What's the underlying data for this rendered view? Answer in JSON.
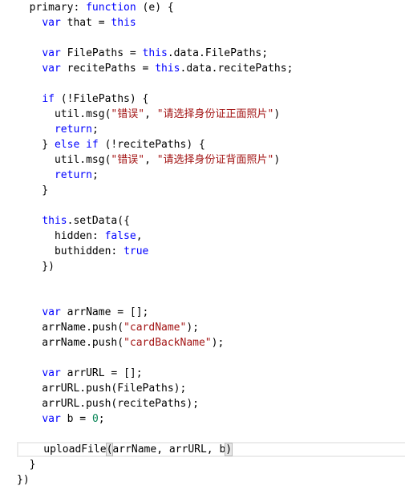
{
  "editor": {
    "current_line": 29,
    "colors": {
      "keyword": "#0000ff",
      "string": "#a31515",
      "number": "#098658",
      "text": "#000000"
    },
    "lines": [
      [
        [
          "t",
          "  primary: "
        ],
        [
          "kw",
          "function"
        ],
        [
          "t",
          " (e) {"
        ]
      ],
      [
        [
          "t",
          "    "
        ],
        [
          "kw",
          "var"
        ],
        [
          "t",
          " that = "
        ],
        [
          "kw",
          "this"
        ]
      ],
      [],
      [
        [
          "t",
          "    "
        ],
        [
          "kw",
          "var"
        ],
        [
          "t",
          " FilePaths = "
        ],
        [
          "kw",
          "this"
        ],
        [
          "t",
          ".data.FilePaths;"
        ]
      ],
      [
        [
          "t",
          "    "
        ],
        [
          "kw",
          "var"
        ],
        [
          "t",
          " recitePaths = "
        ],
        [
          "kw",
          "this"
        ],
        [
          "t",
          ".data.recitePaths;"
        ]
      ],
      [],
      [
        [
          "t",
          "    "
        ],
        [
          "kw",
          "if"
        ],
        [
          "t",
          " (!FilePaths) {"
        ]
      ],
      [
        [
          "t",
          "      util.msg("
        ],
        [
          "str",
          "\"错误\""
        ],
        [
          "t",
          ", "
        ],
        [
          "str",
          "\"请选择身份证正面照片\""
        ],
        [
          "t",
          ")"
        ]
      ],
      [
        [
          "t",
          "      "
        ],
        [
          "kw",
          "return"
        ],
        [
          "t",
          ";"
        ]
      ],
      [
        [
          "t",
          "    } "
        ],
        [
          "kw",
          "else"
        ],
        [
          "t",
          " "
        ],
        [
          "kw",
          "if"
        ],
        [
          "t",
          " (!recitePaths) {"
        ]
      ],
      [
        [
          "t",
          "      util.msg("
        ],
        [
          "str",
          "\"错误\""
        ],
        [
          "t",
          ", "
        ],
        [
          "str",
          "\"请选择身份证背面照片\""
        ],
        [
          "t",
          ")"
        ]
      ],
      [
        [
          "t",
          "      "
        ],
        [
          "kw",
          "return"
        ],
        [
          "t",
          ";"
        ]
      ],
      [
        [
          "t",
          "    }"
        ]
      ],
      [],
      [
        [
          "t",
          "    "
        ],
        [
          "kw",
          "this"
        ],
        [
          "t",
          ".setData({"
        ]
      ],
      [
        [
          "t",
          "      hidden: "
        ],
        [
          "kw",
          "false"
        ],
        [
          "t",
          ","
        ]
      ],
      [
        [
          "t",
          "      buthidden: "
        ],
        [
          "kw",
          "true"
        ]
      ],
      [
        [
          "t",
          "    })"
        ]
      ],
      [],
      [],
      [
        [
          "t",
          "    "
        ],
        [
          "kw",
          "var"
        ],
        [
          "t",
          " arrName = [];"
        ]
      ],
      [
        [
          "t",
          "    arrName.push("
        ],
        [
          "str",
          "\"cardName\""
        ],
        [
          "t",
          ");"
        ]
      ],
      [
        [
          "t",
          "    arrName.push("
        ],
        [
          "str",
          "\"cardBackName\""
        ],
        [
          "t",
          ");"
        ]
      ],
      [],
      [
        [
          "t",
          "    "
        ],
        [
          "kw",
          "var"
        ],
        [
          "t",
          " arrURL = [];"
        ]
      ],
      [
        [
          "t",
          "    arrURL.push(FilePaths);"
        ]
      ],
      [
        [
          "t",
          "    arrURL.push(recitePaths);"
        ]
      ],
      [
        [
          "t",
          "    "
        ],
        [
          "kw",
          "var"
        ],
        [
          "t",
          " b = "
        ],
        [
          "num",
          "0"
        ],
        [
          "t",
          ";"
        ]
      ],
      [],
      [
        [
          "t",
          "    uploadFile"
        ],
        [
          "br",
          "("
        ],
        [
          "t",
          "arrName, arrURL, b"
        ],
        [
          "br",
          ")"
        ]
      ],
      [
        [
          "t",
          "  }"
        ]
      ],
      [
        [
          "t",
          "})"
        ]
      ]
    ]
  }
}
